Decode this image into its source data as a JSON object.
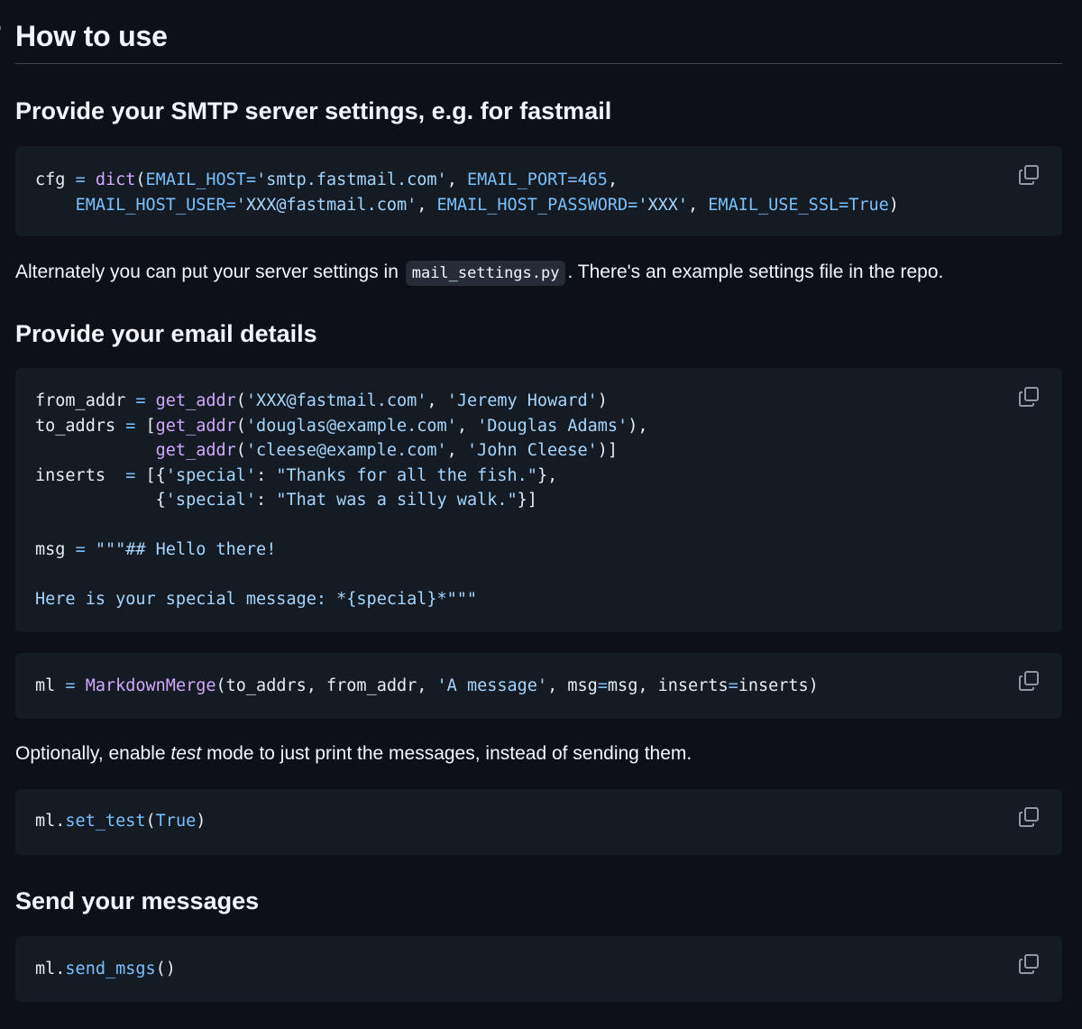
{
  "heading": "How to use",
  "sections": [
    {
      "title": "Provide your SMTP server settings, e.g. for fastmail",
      "code_lines": [
        "cfg = dict(EMAIL_HOST='smtp.fastmail.com', EMAIL_PORT=465,",
        "    EMAIL_HOST_USER='XXX@fastmail.com', EMAIL_HOST_PASSWORD='XXX', EMAIL_USE_SSL=True)"
      ],
      "note_before": "Alternately you can put your server settings in ",
      "note_code": "mail_settings.py",
      "note_after": ". There's an example settings file in the repo."
    },
    {
      "title": "Provide your email details",
      "code_lines": [
        "from_addr = get_addr('XXX@fastmail.com', 'Jeremy Howard')",
        "to_addrs = [get_addr('douglas@example.com', 'Douglas Adams'),",
        "            get_addr('cleese@example.com', 'John Cleese')]",
        "inserts  = [{'special': \"Thanks for all the fish.\"},",
        "            {'special': \"That was a silly walk.\"}]",
        "",
        "msg = \"\"\"## Hello there!",
        "",
        "Here is your special message: *{special}*\"\"\""
      ],
      "merge_code": "ml = MarkdownMerge(to_addrs, from_addr, 'A message', msg=msg, inserts=inserts)",
      "note_prefix": "Optionally, enable ",
      "note_emphasis": "test",
      "note_suffix": " mode to just print the messages, instead of sending them.",
      "test_code": "ml.set_test(True)"
    },
    {
      "title": "Send your messages",
      "send_code": "ml.send_msgs()"
    }
  ],
  "icons": {
    "copy": "copy-icon",
    "anchor": "link-icon"
  },
  "colors": {
    "background": "#0d1117",
    "code_background": "#151b23",
    "text": "#e6edf3",
    "keyword_blue": "#79c0ff",
    "function_purple": "#d2a8ff",
    "string_lightblue": "#a5d6ff"
  }
}
